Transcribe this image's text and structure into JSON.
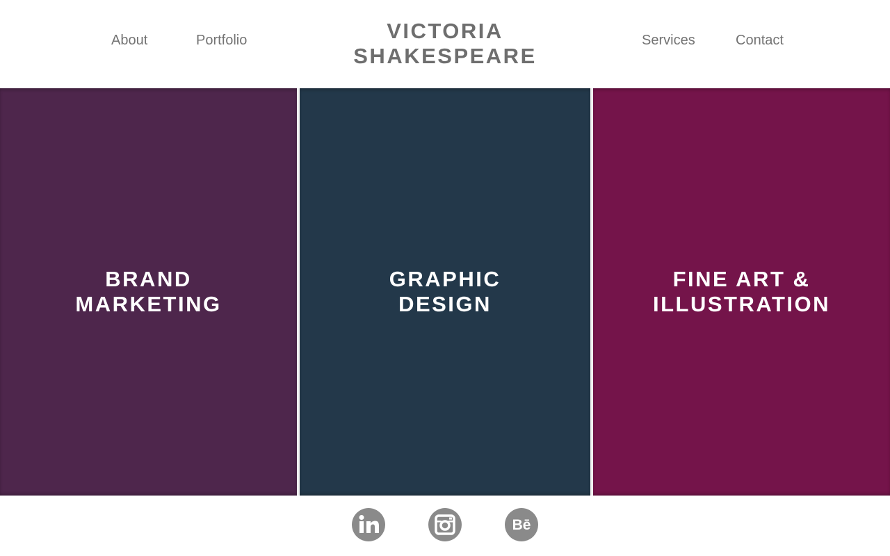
{
  "nav": {
    "left": [
      {
        "label": "About"
      },
      {
        "label": "Portfolio"
      }
    ],
    "right": [
      {
        "label": "Services"
      },
      {
        "label": "Contact"
      }
    ]
  },
  "logo": {
    "line1": "VICTORIA",
    "line2": "SHAKESPEARE"
  },
  "panels": [
    {
      "line1": "BRAND",
      "line2": "MARKETING",
      "color": "#4e264c"
    },
    {
      "line1": "GRAPHIC",
      "line2": "DESIGN",
      "color": "#23384a"
    },
    {
      "line1": "FINE ART &",
      "line2": "ILLUSTRATION",
      "color": "#74144a"
    }
  ],
  "footer": {
    "icons": [
      "linkedin-icon",
      "instagram-icon",
      "behance-icon"
    ],
    "icon_color": "#8a8a8a"
  },
  "colors": {
    "text_gray": "#737373",
    "background": "#ffffff"
  }
}
